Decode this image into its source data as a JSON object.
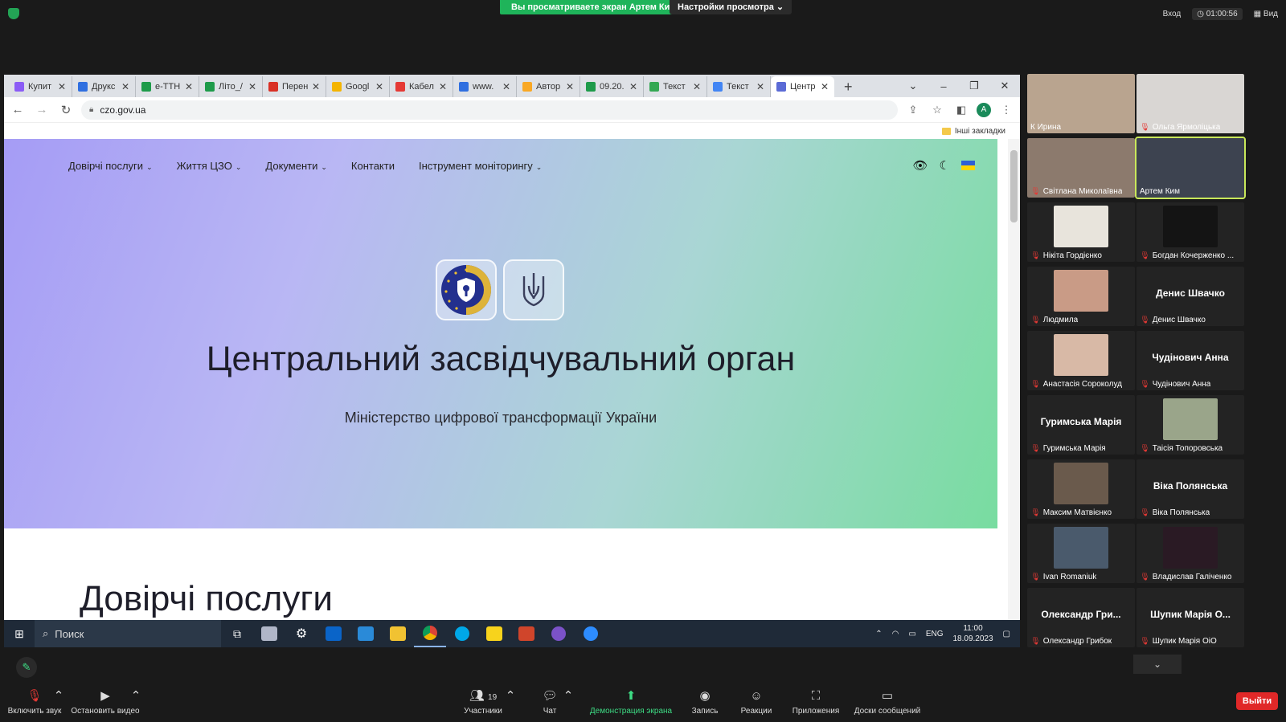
{
  "zoom_top": {
    "share_banner": "Вы просматриваете экран Артем Ким",
    "view_settings": "Настройки просмотра",
    "signin": "Вход",
    "timer": "01:00:56",
    "view": "Вид"
  },
  "browser": {
    "tabs": [
      {
        "title": "Купит",
        "color": "#8b5cf6"
      },
      {
        "title": "Друкс",
        "color": "#2f6fe0"
      },
      {
        "title": "е-ТТН",
        "color": "#1e9b4a"
      },
      {
        "title": "Літо_/",
        "color": "#1e9b4a"
      },
      {
        "title": "Перен",
        "color": "#d93025"
      },
      {
        "title": "Googl",
        "color": "#f4b400"
      },
      {
        "title": "Кабел",
        "color": "#e53935"
      },
      {
        "title": "www.",
        "color": "#2f6fe0"
      },
      {
        "title": "Автор",
        "color": "#f9a825"
      },
      {
        "title": "09.20.",
        "color": "#1e9b4a"
      },
      {
        "title": "Текст",
        "color": "#34a853"
      },
      {
        "title": "Текст",
        "color": "#4285f4"
      },
      {
        "title": "Центр",
        "color": "#5b6bd6"
      }
    ],
    "url": "czo.gov.ua",
    "profile_letter": "A",
    "bookmarks_folder": "Інші закладки"
  },
  "site": {
    "nav": [
      {
        "label": "Довірчі послуги",
        "chevron": true
      },
      {
        "label": "Життя ЦЗО",
        "chevron": true
      },
      {
        "label": "Документи",
        "chevron": true
      },
      {
        "label": "Контакти",
        "chevron": false
      },
      {
        "label": "Інструмент моніторингу",
        "chevron": true
      }
    ],
    "hero_title": "Центральний засвідчувальний орган",
    "hero_subtitle": "Міністерство цифрової трансформації України",
    "section_title": "Довірчі послуги"
  },
  "taskbar": {
    "search_placeholder": "Поиск",
    "lang": "ENG",
    "time": "11:00",
    "date": "18.09.2023"
  },
  "participants": [
    {
      "name": "К Ирина",
      "has_video": true,
      "muted": false,
      "color": "#b9a48f"
    },
    {
      "name": "Ольга Ярмоліцька",
      "has_video": true,
      "muted": true,
      "color": "#d9d6d3"
    },
    {
      "name": "Світлана Миколаївна",
      "has_video": true,
      "muted": true,
      "color": "#8c7a6d"
    },
    {
      "name": "Артем Ким",
      "has_video": true,
      "muted": false,
      "speaking": true,
      "color": "#3d4350"
    },
    {
      "name": "Нікіта Гордієнко",
      "has_video": true,
      "muted": true,
      "color": "#e8e4dc"
    },
    {
      "name": "Богдан Кочерженко ...",
      "has_video": true,
      "muted": true,
      "color": "#141414"
    },
    {
      "name": "Людмила",
      "has_video": true,
      "muted": true,
      "color": "#c99b86"
    },
    {
      "name": "Денис Швачко",
      "has_video": false,
      "muted": true,
      "display_name": "Денис Швачко"
    },
    {
      "name": "Анастасія Сороколуд",
      "has_video": true,
      "muted": true,
      "color": "#d8b9a6"
    },
    {
      "name": "Чудінович Анна",
      "has_video": false,
      "muted": true,
      "display_name": "Чудінович Анна"
    },
    {
      "name": "Гуримська Марія",
      "has_video": false,
      "muted": true,
      "display_name": "Гуримська Марія"
    },
    {
      "name": "Таісія Топоровська",
      "has_video": true,
      "muted": true,
      "color": "#9aa58a"
    },
    {
      "name": "Максим Матвієнко",
      "has_video": true,
      "muted": true,
      "color": "#6a5a4c"
    },
    {
      "name": "Віка Полянська",
      "has_video": false,
      "muted": true,
      "display_name": "Віка Полянська"
    },
    {
      "name": "Ivan Romaniuk",
      "has_video": true,
      "muted": true,
      "color": "#4a5a6c"
    },
    {
      "name": "Владислав Галіченко",
      "has_video": true,
      "muted": true,
      "color": "#2a1a24"
    },
    {
      "name": "Олександр Грибок",
      "has_video": false,
      "muted": true,
      "display_name": "Олександр Гри..."
    },
    {
      "name": "Шупик Марія ОіО",
      "has_video": false,
      "muted": true,
      "display_name": "Шупик Марія О..."
    }
  ],
  "zoom_bar": {
    "unmute": "Включить звук",
    "stop_video": "Остановить видео",
    "participants": "Участники",
    "participants_count": "19",
    "chat": "Чат",
    "share": "Демонстрация экрана",
    "record": "Запись",
    "reactions": "Реакции",
    "apps": "Приложения",
    "whiteboards": "Доски сообщений",
    "leave": "Выйти"
  }
}
